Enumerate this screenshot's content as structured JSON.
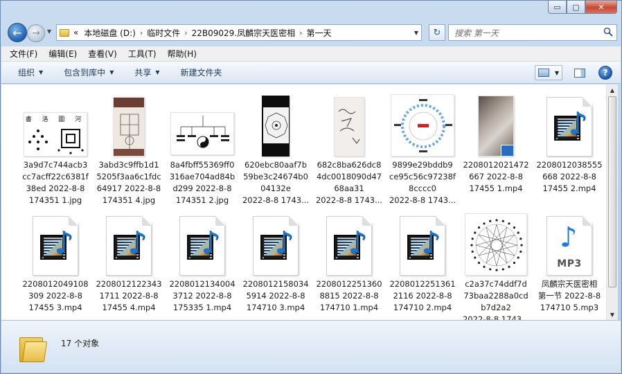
{
  "window": {
    "caption_buttons": {
      "minimize": "▭",
      "maximize": "▢",
      "close": "✕"
    }
  },
  "nav": {
    "back_glyph": "←",
    "forward_glyph": "→",
    "dropdown_glyph": "▼",
    "breadcrumb_lead": "«",
    "breadcrumbs": [
      "本地磁盘 (D:)",
      "临时文件",
      "22B09029.凤麟宗天医密相",
      "第一天"
    ],
    "refresh_glyph": "↻",
    "search_placeholder": "搜索 第一天"
  },
  "menubar": {
    "items": [
      "文件(F)",
      "编辑(E)",
      "查看(V)",
      "工具(T)",
      "帮助(H)"
    ]
  },
  "commandbar": {
    "items": [
      {
        "label": "组织",
        "dropdown": true
      },
      {
        "label": "包含到库中",
        "dropdown": true
      },
      {
        "label": "共享",
        "dropdown": true
      },
      {
        "label": "新建文件夹",
        "dropdown": false
      }
    ],
    "dropdown_glyph": "▼",
    "help_glyph": "?"
  },
  "files": [
    {
      "name_lines": [
        "3a9d7c744acb3",
        "cc7acff22c6381f",
        "38ed 2022-8-8",
        "174351 1.jpg"
      ],
      "kind": "image-diagram",
      "icon": "image-thumbnail-icon"
    },
    {
      "name_lines": [
        "3abd3c9ffb1d1",
        "5205f3aa6c1fdc",
        "64917 2022-8-8",
        "174351 4.jpg"
      ],
      "kind": "image-paper",
      "icon": "image-thumbnail-icon"
    },
    {
      "name_lines": [
        "8a4fbff55369ff0",
        "316ae704ad84b",
        "d299 2022-8-8",
        "174351 2.jpg"
      ],
      "kind": "image-chart",
      "icon": "image-thumbnail-icon"
    },
    {
      "name_lines": [
        "620ebc80aaf7b",
        "59be3c24674b0",
        "04132e",
        "2022-8-8 1743..."
      ],
      "kind": "image-bagua",
      "icon": "image-thumbnail-icon"
    },
    {
      "name_lines": [
        "682c8ba626dc8",
        "4dc0018090d47",
        "68aa31",
        "2022-8-8 1743..."
      ],
      "kind": "image-handwriting",
      "icon": "image-thumbnail-icon"
    },
    {
      "name_lines": [
        "9899e29bddb9",
        "ce95c56c97238f",
        "8cccc0",
        "2022-8-8 1743..."
      ],
      "kind": "image-wheel",
      "icon": "image-thumbnail-icon"
    },
    {
      "name_lines": [
        "2208012021472",
        "667 2022-8-8",
        "17455 1.mp4"
      ],
      "kind": "video-photo",
      "icon": "video-thumbnail-icon"
    },
    {
      "name_lines": [
        "2208012038555",
        "668 2022-8-8",
        "17455 2.mp4"
      ],
      "kind": "video",
      "icon": "video-file-icon"
    },
    {
      "name_lines": [
        "2208012049108",
        "309 2022-8-8",
        "17455 3.mp4"
      ],
      "kind": "video",
      "icon": "video-file-icon"
    },
    {
      "name_lines": [
        "2208012122343",
        "1711 2022-8-8",
        "17455 4.mp4"
      ],
      "kind": "video",
      "icon": "video-file-icon"
    },
    {
      "name_lines": [
        "2208012134004",
        "3712 2022-8-8",
        "175335 1.mp4"
      ],
      "kind": "video",
      "icon": "video-file-icon"
    },
    {
      "name_lines": [
        "2208012158034",
        "5914 2022-8-8",
        "174710 3.mp4"
      ],
      "kind": "video",
      "icon": "video-file-icon"
    },
    {
      "name_lines": [
        "2208012251360",
        "8815 2022-8-8",
        "174710 1.mp4"
      ],
      "kind": "video",
      "icon": "video-file-icon"
    },
    {
      "name_lines": [
        "2208012251361",
        "2116 2022-8-8",
        "174710 2.mp4"
      ],
      "kind": "video",
      "icon": "video-file-icon"
    },
    {
      "name_lines": [
        "c2a37c74ddf7d",
        "73baa2288a0cd",
        "b7d2a2",
        "2022-8-8 1743..."
      ],
      "kind": "image-star",
      "icon": "image-thumbnail-icon"
    },
    {
      "name_lines": [
        "凤麟宗天医密相",
        "第一节 2022-8-8",
        "174710 5.mp3"
      ],
      "kind": "audio",
      "icon": "mp3-file-icon",
      "badge": "MP3"
    }
  ],
  "details": {
    "count_text": "17 个对象"
  },
  "icon_glyphs": {
    "music_note": "♪",
    "search": "search-icon"
  },
  "colors": {
    "accent": "#1e7bd1",
    "window_frame": "#b9d1ea"
  },
  "image_text": {
    "diagram_title": "書 洛 圖 河"
  }
}
